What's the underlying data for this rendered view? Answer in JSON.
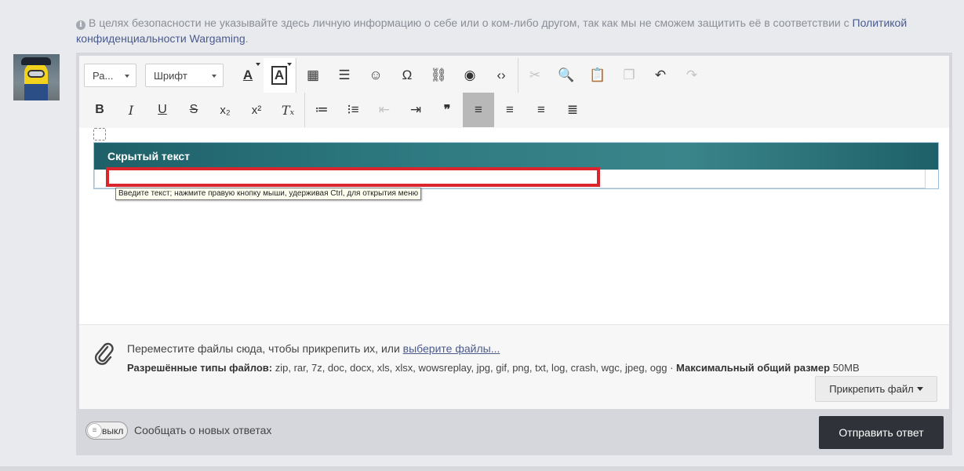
{
  "notice": {
    "icon": "info-icon",
    "text": "В целях безопасности не указывайте здесь личную информацию о себе или о ком-либо другом, так как мы не сможем защитить её в соответствии с ",
    "link": "Политикой конфиденциальности Wargaming",
    "suffix": "."
  },
  "toolbar": {
    "format_label": "Ра...",
    "font_label": "Шрифт",
    "row1": [
      {
        "name": "text-color-icon",
        "glyph": "A",
        "disabled": false
      },
      {
        "name": "background-color-icon",
        "glyph": "A",
        "disabled": false
      },
      {
        "name": "table-icon",
        "glyph": "▦",
        "disabled": false
      },
      {
        "name": "horizontal-line-icon",
        "glyph": "☰",
        "disabled": false
      },
      {
        "name": "emoji-icon",
        "glyph": "☺",
        "disabled": false
      },
      {
        "name": "special-char-icon",
        "glyph": "Ω",
        "disabled": false
      },
      {
        "name": "link-icon",
        "glyph": "⛓",
        "disabled": false
      },
      {
        "name": "spoiler-eye-icon",
        "glyph": "◉",
        "disabled": false
      },
      {
        "name": "source-code-icon",
        "glyph": "‹›",
        "disabled": false
      },
      {
        "name": "cut-icon",
        "glyph": "✂",
        "disabled": true
      },
      {
        "name": "find-icon",
        "glyph": "🔍",
        "disabled": false
      },
      {
        "name": "paste-icon",
        "glyph": "📋",
        "disabled": false
      },
      {
        "name": "copy-icon",
        "glyph": "❐",
        "disabled": true
      },
      {
        "name": "undo-icon",
        "glyph": "↶",
        "disabled": false
      },
      {
        "name": "redo-icon",
        "glyph": "↷",
        "disabled": true
      }
    ],
    "row2": [
      {
        "name": "bold-icon",
        "glyph": "B",
        "cls": "bold"
      },
      {
        "name": "italic-icon",
        "glyph": "I",
        "cls": "ital"
      },
      {
        "name": "underline-icon",
        "glyph": "U",
        "cls": "und"
      },
      {
        "name": "strikethrough-icon",
        "glyph": "S",
        "cls": "strike"
      },
      {
        "name": "subscript-icon",
        "glyph": "x₂",
        "cls": "sub"
      },
      {
        "name": "superscript-icon",
        "glyph": "x²",
        "cls": "sup"
      },
      {
        "name": "remove-format-icon",
        "glyph": "Tₓ",
        "cls": "ital"
      },
      {
        "name": "numbered-list-icon",
        "glyph": "≔",
        "cls": ""
      },
      {
        "name": "bulleted-list-icon",
        "glyph": "⁝≡",
        "cls": ""
      },
      {
        "name": "outdent-icon",
        "glyph": "⇤",
        "cls": "disabled"
      },
      {
        "name": "indent-icon",
        "glyph": "⇥",
        "cls": ""
      },
      {
        "name": "blockquote-icon",
        "glyph": "❞",
        "cls": "bold"
      },
      {
        "name": "align-left-icon",
        "glyph": "≡",
        "cls": "active"
      },
      {
        "name": "align-center-icon",
        "glyph": "≡",
        "cls": ""
      },
      {
        "name": "align-right-icon",
        "glyph": "≡",
        "cls": ""
      },
      {
        "name": "justify-icon",
        "glyph": "≣",
        "cls": ""
      }
    ]
  },
  "editor": {
    "hidden_title": "Скрытый текст",
    "tooltip": "Введите текст; нажмите правую кнопку мыши, удерживая Ctrl, для открытия меню"
  },
  "attach": {
    "icon": "paperclip-icon",
    "drop_text": "Переместите файлы сюда, чтобы прикрепить их, или ",
    "choose_link": "выберите файлы...",
    "types_label": "Разрешённые типы файлов:",
    "types": " zip, rar, 7z, doc, docx, xls, xlsx, wowsreplay, jpg, gif, png, txt, log, crash, wgc, jpeg, ogg · ",
    "max_label": "Максимальный общий размер",
    "max_value": " 50MB",
    "button": "Прикрепить файл"
  },
  "footer": {
    "toggle_text": "выкл",
    "notify_label": "Сообщать о новых ответах",
    "submit": "Отправить ответ"
  }
}
